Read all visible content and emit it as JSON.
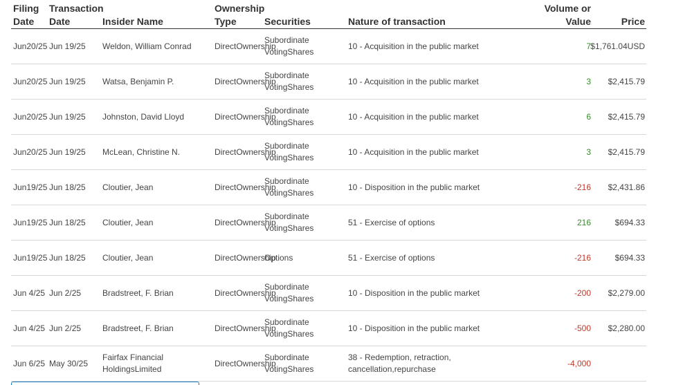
{
  "table": {
    "headers": {
      "filing_date": [
        "Filing",
        "Date"
      ],
      "transaction_date": [
        "Transaction",
        "Date"
      ],
      "insider_name": "Insider Name",
      "ownership_type": [
        "Ownership",
        "Type"
      ],
      "securities": "Securities",
      "nature": "Nature of transaction",
      "volume": [
        "Volume or",
        "Value"
      ],
      "price": "Price"
    },
    "rows": [
      {
        "filing": [
          "Jun",
          "20/25"
        ],
        "txn": "Jun 19/25",
        "insider": [
          "Weldon, William Conrad"
        ],
        "ownership": [
          "Direct",
          "Ownership"
        ],
        "securities": [
          "Subordinate Voting",
          "Shares"
        ],
        "nature": [
          "10 - Acquisition in the public market"
        ],
        "volume": "7",
        "volume_sign": "pos",
        "price": [
          "$1,761.04",
          "USD"
        ]
      },
      {
        "filing": [
          "Jun",
          "20/25"
        ],
        "txn": "Jun 19/25",
        "insider": [
          "Watsa, Benjamin P."
        ],
        "ownership": [
          "Direct",
          "Ownership"
        ],
        "securities": [
          "Subordinate Voting",
          "Shares"
        ],
        "nature": [
          "10 - Acquisition in the public market"
        ],
        "volume": "3",
        "volume_sign": "pos",
        "price": [
          "$2,415.79"
        ]
      },
      {
        "filing": [
          "Jun",
          "20/25"
        ],
        "txn": "Jun 19/25",
        "insider": [
          "Johnston, David Lloyd"
        ],
        "ownership": [
          "Direct",
          "Ownership"
        ],
        "securities": [
          "Subordinate Voting",
          "Shares"
        ],
        "nature": [
          "10 - Acquisition in the public market"
        ],
        "volume": "6",
        "volume_sign": "pos",
        "price": [
          "$2,415.79"
        ]
      },
      {
        "filing": [
          "Jun",
          "20/25"
        ],
        "txn": "Jun 19/25",
        "insider": [
          "McLean, Christine N."
        ],
        "ownership": [
          "Direct",
          "Ownership"
        ],
        "securities": [
          "Subordinate Voting",
          "Shares"
        ],
        "nature": [
          "10 - Acquisition in the public market"
        ],
        "volume": "3",
        "volume_sign": "pos",
        "price": [
          "$2,415.79"
        ]
      },
      {
        "filing": [
          "Jun",
          "19/25"
        ],
        "txn": "Jun 18/25",
        "insider": [
          "Cloutier, Jean"
        ],
        "ownership": [
          "Direct",
          "Ownership"
        ],
        "securities": [
          "Subordinate Voting",
          "Shares"
        ],
        "nature": [
          "10 - Disposition in the public market"
        ],
        "volume": "-216",
        "volume_sign": "neg",
        "price": [
          "$2,431.86"
        ]
      },
      {
        "filing": [
          "Jun",
          "19/25"
        ],
        "txn": "Jun 18/25",
        "insider": [
          "Cloutier, Jean"
        ],
        "ownership": [
          "Direct",
          "Ownership"
        ],
        "securities": [
          "Subordinate Voting",
          "Shares"
        ],
        "nature": [
          "51 - Exercise of options"
        ],
        "volume": "216",
        "volume_sign": "pos",
        "price": [
          "$694.33"
        ]
      },
      {
        "filing": [
          "Jun",
          "19/25"
        ],
        "txn": "Jun 18/25",
        "insider": [
          "Cloutier, Jean"
        ],
        "ownership": [
          "Direct",
          "Ownership"
        ],
        "securities": [
          "Options"
        ],
        "nature": [
          "51 - Exercise of options"
        ],
        "volume": "-216",
        "volume_sign": "neg",
        "price": [
          "$694.33"
        ]
      },
      {
        "filing": [
          "Jun 4/25"
        ],
        "txn": "Jun 2/25",
        "insider": [
          "Bradstreet, F. Brian"
        ],
        "ownership": [
          "Direct",
          "Ownership"
        ],
        "securities": [
          "Subordinate Voting",
          "Shares"
        ],
        "nature": [
          "10 - Disposition in the public market"
        ],
        "volume": "-200",
        "volume_sign": "neg",
        "price": [
          "$2,279.00"
        ]
      },
      {
        "filing": [
          "Jun 4/25"
        ],
        "txn": "Jun 2/25",
        "insider": [
          "Bradstreet, F. Brian"
        ],
        "ownership": [
          "Direct",
          "Ownership"
        ],
        "securities": [
          "Subordinate Voting",
          "Shares"
        ],
        "nature": [
          "10 - Disposition in the public market"
        ],
        "volume": "-500",
        "volume_sign": "neg",
        "price": [
          "$2,280.00"
        ]
      },
      {
        "filing": [
          "Jun 6/25"
        ],
        "txn": "May 30/25",
        "insider": [
          "Fairfax Financial Holdings",
          "Limited"
        ],
        "ownership": [
          "Direct",
          "Ownership"
        ],
        "securities": [
          "Subordinate Voting",
          "Shares"
        ],
        "nature": [
          "38 - Redemption, retraction, cancellation,",
          "repurchase"
        ],
        "volume": "-4,000",
        "volume_sign": "neg",
        "price": []
      }
    ]
  },
  "colors": {
    "positive": "#3a8a2e",
    "negative": "#c0392b",
    "peek_border": "#1a7bc1"
  }
}
